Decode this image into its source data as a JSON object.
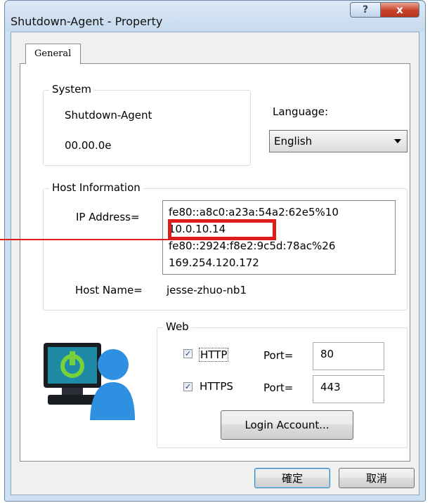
{
  "window": {
    "title": "Shutdown-Agent - Property",
    "help_label": "?",
    "close_label": "x"
  },
  "tabs": [
    {
      "label": "General"
    }
  ],
  "system": {
    "group_label": "System",
    "name": "Shutdown-Agent",
    "version": "00.00.0e"
  },
  "language": {
    "label": "Language:",
    "selected": "English"
  },
  "host": {
    "group_label": "Host Information",
    "ip_label": "IP Address=",
    "ip_addresses": [
      "fe80::a8c0:a23a:54a2:62e5%10",
      "10.0.10.14",
      "fe80::2924:f8e2:9c5d:78ac%26",
      "169.254.120.172"
    ],
    "host_name_label": "Host Name=",
    "host_name": "jesse-zhuo-nb1"
  },
  "web": {
    "group_label": "Web",
    "http": {
      "label": "HTTP",
      "checked": true,
      "port_label": "Port=",
      "port": "80"
    },
    "https": {
      "label": "HTTPS",
      "checked": true,
      "port_label": "Port=",
      "port": "443"
    },
    "login_button": "Login Account..."
  },
  "footer": {
    "ok": "確定",
    "cancel": "取消"
  },
  "colors": {
    "highlight": "#e01b1b",
    "icon_screen": "#1e8aa6",
    "icon_power": "#77d13b",
    "icon_person": "#2f8fe0"
  }
}
